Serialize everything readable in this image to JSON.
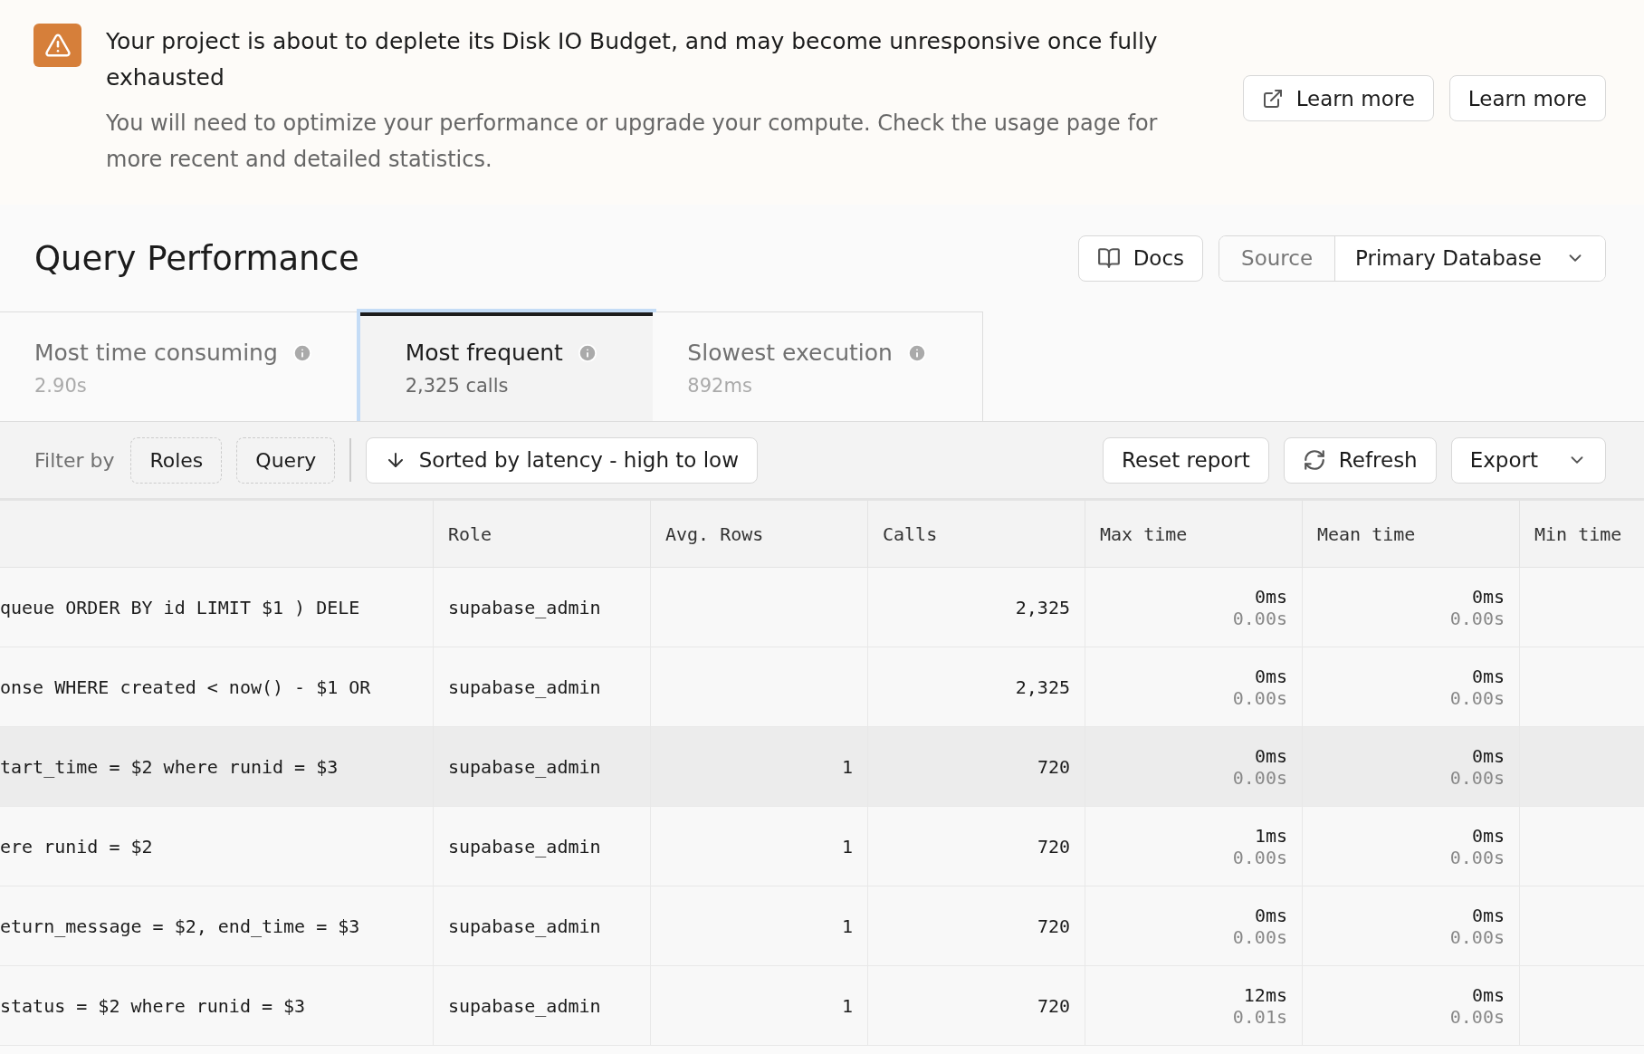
{
  "banner": {
    "title": "Your project is about to deplete its Disk IO Budget, and may become unresponsive once fully exhausted",
    "message": "You will need to optimize your performance or upgrade your compute. Check the usage page for more recent and detailed statistics.",
    "buttons": [
      {
        "label": "Learn more",
        "kind": "external"
      },
      {
        "label": "Learn more",
        "kind": "plain"
      }
    ]
  },
  "header": {
    "title": "Query Performance",
    "docs": "Docs",
    "source_label": "Source",
    "source_value": "Primary Database"
  },
  "tabs": [
    {
      "label": "Most time consuming",
      "value": "2.90s",
      "selected": false
    },
    {
      "label": "Most frequent",
      "value": "2,325 calls",
      "selected": true
    },
    {
      "label": "Slowest execution",
      "value": "892ms",
      "selected": false
    }
  ],
  "filter_bar": {
    "label": "Filter by",
    "filters": [
      "Roles",
      "Query"
    ],
    "sort": "Sorted by latency - high to low",
    "actions": [
      {
        "label": "Reset report",
        "kind": "plain"
      },
      {
        "label": "Refresh",
        "kind": "refresh"
      },
      {
        "label": "Export",
        "kind": "dropdown"
      }
    ]
  },
  "table": {
    "columns": [
      "Role",
      "Avg. Rows",
      "Calls",
      "Max time",
      "Mean time",
      "Min time"
    ],
    "rows": [
      {
        "query": "queue ORDER BY id LIMIT $1 ) DELE",
        "role": "supabase_admin",
        "calls": "2,325",
        "max_ms": "0ms",
        "max_s": "0.00s",
        "mean_ms": "0ms",
        "mean_s": "0.00s",
        "selected": false
      },
      {
        "query": "onse WHERE created < now() - $1 OR",
        "role": "supabase_admin",
        "calls": "2,325",
        "max_ms": "0ms",
        "max_s": "0.00s",
        "mean_ms": "0ms",
        "mean_s": "0.00s",
        "selected": false
      },
      {
        "query": "tart_time = $2 where runid = $3",
        "role": "supabase_admin",
        "avg_rows": "1",
        "calls": "720",
        "max_ms": "0ms",
        "max_s": "0.00s",
        "mean_ms": "0ms",
        "mean_s": "0.00s",
        "selected": true
      },
      {
        "query": "ere runid = $2",
        "role": "supabase_admin",
        "avg_rows": "1",
        "calls": "720",
        "max_ms": "1ms",
        "max_s": "0.00s",
        "mean_ms": "0ms",
        "mean_s": "0.00s",
        "selected": false
      },
      {
        "query": "eturn_message = $2, end_time = $3",
        "role": "supabase_admin",
        "avg_rows": "1",
        "calls": "720",
        "max_ms": "0ms",
        "max_s": "0.00s",
        "mean_ms": "0ms",
        "mean_s": "0.00s",
        "selected": false
      },
      {
        "query": "status = $2 where runid = $3",
        "role": "supabase_admin",
        "avg_rows": "1",
        "calls": "720",
        "max_ms": "12ms",
        "max_s": "0.01s",
        "mean_ms": "0ms",
        "mean_s": "0.00s",
        "selected": false
      }
    ]
  }
}
